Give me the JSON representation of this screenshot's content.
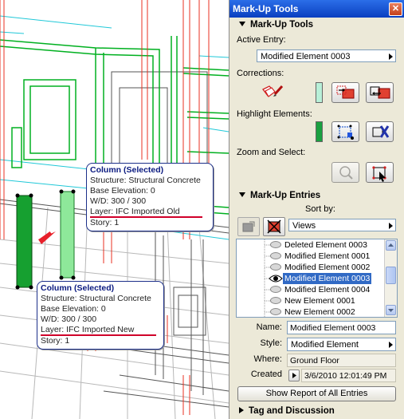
{
  "palette": {
    "title": "Mark-Up Tools",
    "close_icon": "close-icon"
  },
  "markup_tools": {
    "section_label": "Mark-Up Tools",
    "active_entry_label": "Active Entry:",
    "active_entry_value": "Modified Element 0003",
    "corrections_label": "Corrections:",
    "corrections_swatch_color": "#b8f0d8",
    "highlight_label": "Highlight Elements:",
    "highlight_swatch_color": "#1aa040",
    "zoom_label": "Zoom and Select:"
  },
  "markup_entries": {
    "section_label": "Mark-Up Entries",
    "sort_by_label": "Sort by:",
    "sort_by_value": "Views",
    "entries": [
      {
        "label": "Deleted Element 0003"
      },
      {
        "label": "Modified Element 0001"
      },
      {
        "label": "Modified Element 0002"
      },
      {
        "label": "Modified Element 0003",
        "selected": true
      },
      {
        "label": "Modified Element 0004"
      },
      {
        "label": "New Element 0001"
      },
      {
        "label": "New Element 0002"
      }
    ],
    "name_label": "Name:",
    "name_value": "Modified Element 0003",
    "style_label": "Style:",
    "style_value": "Modified Element",
    "where_label": "Where:",
    "where_value": "Ground Floor",
    "created_label": "Created",
    "created_value": "3/6/2010 12:01:49 PM",
    "report_button": "Show Report of All Entries"
  },
  "tag_discussion": {
    "section_label": "Tag and Discussion"
  },
  "viewport": {
    "tooltip_old": {
      "title": "Column (Selected)",
      "structure": "Structure: Structural Concrete",
      "base_elevation": "Base Elevation: 0",
      "wd": "W/D: 300 / 300",
      "layer": "Layer: IFC Imported Old",
      "story": "Story: 1"
    },
    "tooltip_new": {
      "title": "Column (Selected)",
      "structure": "Structure: Structural Concrete",
      "base_elevation": "Base Elevation: 0",
      "wd": "W/D: 300 / 300",
      "layer": "Layer: IFC Imported New",
      "story": "Story: 1"
    },
    "colors": {
      "green": "#00b020",
      "red": "#e83020",
      "cyan": "#20c8d8",
      "underline": "#d0002a"
    }
  }
}
